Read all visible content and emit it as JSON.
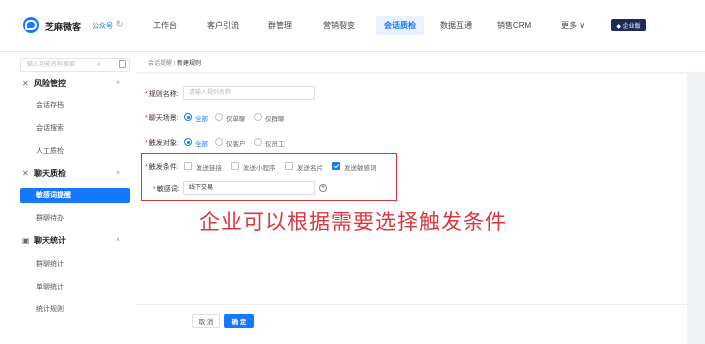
{
  "header": {
    "brand": "芝麻微客",
    "account": "公众号",
    "sync_icon": "sync-icon",
    "nav": [
      "工作台",
      "客户引流",
      "群管理",
      "营销裂变",
      "会话质检",
      "数据互通",
      "销售CRM",
      "更多 ∨"
    ],
    "active_nav": "会话质检",
    "vip_label": "◆ 企业版"
  },
  "sidebar": {
    "search_placeholder": "输入功能名称搜索",
    "groups": [
      {
        "label": "风险管控",
        "icon": "shield-icon",
        "items": [
          "会话存档",
          "会话搜索",
          "人工质检"
        ]
      },
      {
        "label": "聊天质检",
        "icon": "inspect-icon",
        "items": [
          "敏感词提醒",
          "群聊待办"
        ]
      },
      {
        "label": "聊天统计",
        "icon": "stats-icon",
        "items": [
          "群聊统计",
          "单聊统计",
          "统计规则"
        ]
      }
    ],
    "active_item": "敏感词提醒"
  },
  "breadcrumb": {
    "parent": "会话提醒",
    "sep": "/",
    "current": "新建规则"
  },
  "form": {
    "rule_name": {
      "label": "规则名称:",
      "placeholder": "请输入规则名称"
    },
    "scene": {
      "label": "聊天场景:",
      "options": [
        "全部",
        "仅单聊",
        "仅群聊"
      ],
      "selected": "全部"
    },
    "target": {
      "label": "触发对象:",
      "options": [
        "全部",
        "仅客户",
        "仅员工"
      ],
      "selected": "全部"
    },
    "condition": {
      "label": "触发条件:",
      "options": [
        "发送链接",
        "发送小程序",
        "发送名片",
        "发送敏感词"
      ],
      "checked": [
        "发送敏感词"
      ]
    },
    "keyword": {
      "label": "敏感词:",
      "value": "线下交易"
    }
  },
  "annotation": "企业可以根据需要选择触发条件",
  "footer": {
    "cancel": "取 消",
    "ok": "确 定"
  },
  "colors": {
    "primary": "#1677ff",
    "annotation": "#d9363e",
    "nav_dark": "#1e2b57"
  }
}
